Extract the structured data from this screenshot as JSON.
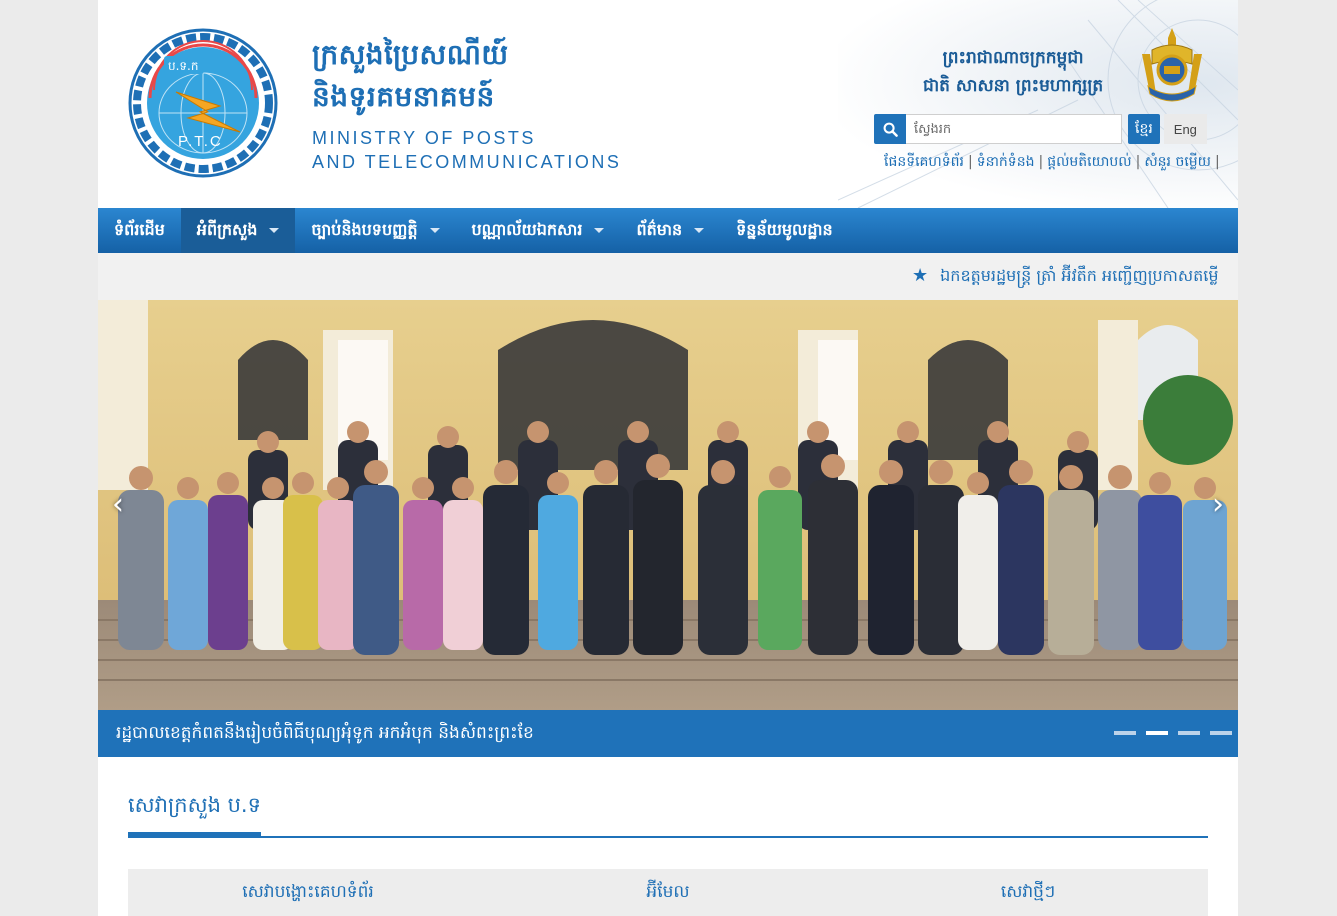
{
  "header": {
    "brand_kh_line1": "ក្រសួងប្រៃសណីយ៍",
    "brand_kh_line2": "និងទូរគមនាគមន៍",
    "brand_en_line1": "MINISTRY OF POSTS",
    "brand_en_line2": "AND TELECOMMUNICATIONS",
    "logo_text_top": "ប.ទ.ក",
    "logo_text_bottom": "P.T.C",
    "royal_line1": "ព្រះរាជាណាចក្រកម្ពុជា",
    "royal_line2": "ជាតិ សាសនា ព្រះមហាក្សត្រ"
  },
  "search": {
    "placeholder": "ស្វែងរក",
    "lang_kh": "ខ្មែរ",
    "lang_en": "Eng"
  },
  "toplinks": [
    "ផែនទីគេហទំព័រ",
    "ទំនាក់ទំនង",
    "ផ្តល់មតិយោបល់",
    "សំនួរ ចម្លើយ"
  ],
  "nav": {
    "items": [
      {
        "label": "ទំព័រដើម"
      },
      {
        "label": "អំពីក្រសួង"
      },
      {
        "label": "ច្បាប់និងបទបញ្ញត្តិ"
      },
      {
        "label": "បណ្ណាល័យឯកសារ"
      },
      {
        "label": "ព័ត៌មាន"
      },
      {
        "label": "ទិន្នន័យមូលដ្ឋាន"
      }
    ]
  },
  "ticker": {
    "text": "ឯកឧត្តមរដ្ឋមន្រ្តី ត្រាំ អ៊ីវតឹក អញ្ជើញប្រកាសតម្លើ"
  },
  "slider": {
    "caption": "រដ្ឋបាលខេត្តកំពតនឹងរៀបចំពិធីបុណ្យអុំទូក អកអំបុក និងសំពះព្រះខែ",
    "prev_glyph": "‹",
    "next_glyph": "›",
    "slide_count": 4,
    "active_index": 1
  },
  "services": {
    "title": "សេវាក្រសួង ប.ទ",
    "items": [
      {
        "label": "សេវាបង្ហោះគេហទំព័រ"
      },
      {
        "label": "អ៊ីមែល"
      },
      {
        "label": "សេវាថ្មីៗ"
      }
    ]
  },
  "colors": {
    "primary": "#1f72b9",
    "brand_text": "#1e6fb5",
    "ticker_bg": "#f1f1f1"
  }
}
